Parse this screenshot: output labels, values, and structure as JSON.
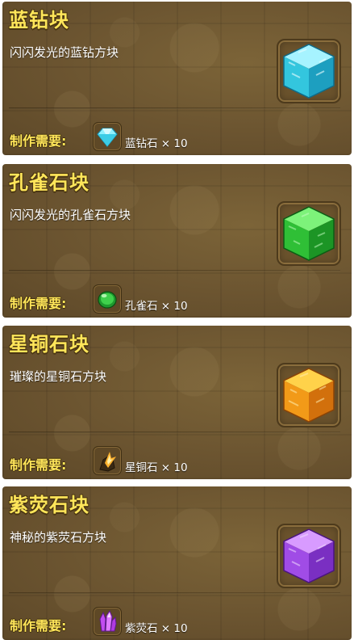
{
  "recipes": [
    {
      "title": "蓝钻块",
      "description": "闪闪发光的蓝钻方块",
      "requirement_label": "制作需要:",
      "material": "蓝钻石 × 10",
      "block_color": "#3fd6e8",
      "block_icon": "blue-diamond-block-icon",
      "material_icon": "blue-diamond-gem-icon"
    },
    {
      "title": "孔雀石块",
      "description": "闪闪发光的孔雀石方块",
      "requirement_label": "制作需要:",
      "material": "孔雀石 × 10",
      "block_color": "#2fc43a",
      "block_icon": "malachite-block-icon",
      "material_icon": "malachite-orb-icon"
    },
    {
      "title": "星铜石块",
      "description": "璀璨的星铜石方块",
      "requirement_label": "制作需要:",
      "material": "星铜石 × 10",
      "block_color": "#f5a21c",
      "block_icon": "star-copper-block-icon",
      "material_icon": "star-copper-ore-icon"
    },
    {
      "title": "紫荧石块",
      "description": "神秘的紫荧石方块",
      "requirement_label": "制作需要:",
      "material": "紫荧石 × 10",
      "block_color": "#a24ee8",
      "block_icon": "purple-fluorite-block-icon",
      "material_icon": "purple-fluorite-crystal-icon"
    }
  ]
}
